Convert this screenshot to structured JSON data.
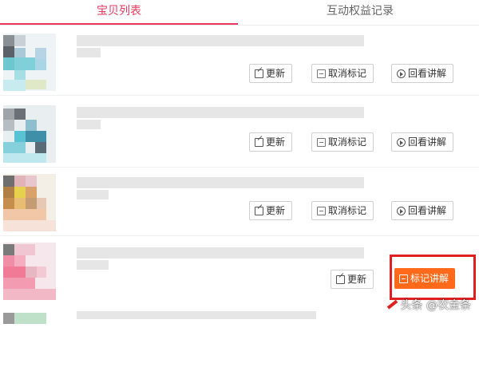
{
  "tabs": {
    "goods_list": "宝贝列表",
    "interactive_rights": "互动权益记录"
  },
  "buttons": {
    "update": "更新",
    "unmark": "取消标记",
    "replay": "回看讲解",
    "mark": "标记讲解"
  },
  "watermark": "头条 @农金条",
  "colors": {
    "accent_pink": "#e8385d",
    "mark_orange": "#ff6a1a",
    "highlight_red": "#e02020"
  },
  "icons": [
    "edit-icon",
    "unmark-icon",
    "play-circle-icon",
    "mark-icon"
  ]
}
